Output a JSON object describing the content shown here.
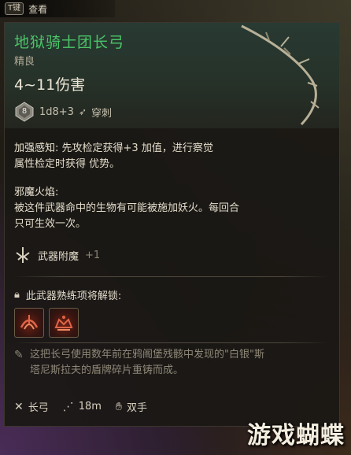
{
  "topbar": {
    "key": "T键",
    "label": "查看"
  },
  "item": {
    "name": "地狱骑士团长弓",
    "rarity": "精良",
    "damage": "4~11伤害",
    "die_number": "8",
    "damage_formula": "1d8+3",
    "damage_type": "穿刺"
  },
  "sections": {
    "feature1_title": "加强感知:",
    "feature1_line1": "先攻检定获得+3 加值，进行察觉",
    "feature1_line2": "属性检定时获得 优势。",
    "feature2_title": "邪魔火焰:",
    "feature2_line1": "被这件武器命中的生物有可能被施加妖火。每回合",
    "feature2_line2": "只可生效一次。",
    "enchant_label": "武器附魔",
    "enchant_value": "+1",
    "proficiency_title": "此武器熟练项将解锁:"
  },
  "description": {
    "line1": "这把长弓使用数年前在鸦阁堡残骸中发现的\"白银\"斯",
    "line2": "塔尼斯拉夫的盾牌碎片重铸而成。"
  },
  "footer": {
    "weapon_type": "长弓",
    "range": "18m",
    "handedness": "双手"
  },
  "watermark": "游戏蝴蝶",
  "colors": {
    "rare_green": "#4cc568",
    "text": "#e3dccb",
    "muted": "#8d8676"
  }
}
